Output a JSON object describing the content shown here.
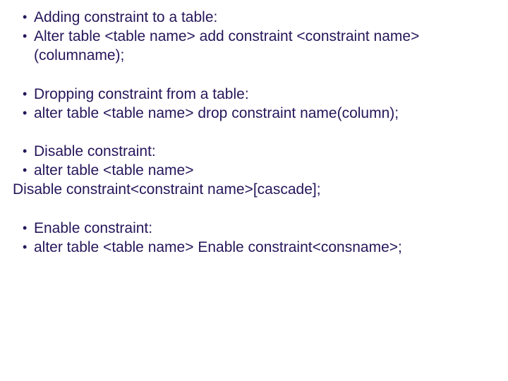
{
  "groups": [
    {
      "lines": [
        "Adding constraint to a table:",
        "Alter table <table name> add constraint <constraint name>(columname);"
      ]
    },
    {
      "lines": [
        "Dropping constraint from a table:",
        "alter table <table name> drop constraint name(column);"
      ]
    },
    {
      "lines": [
        "Disable constraint:",
        "alter table <table name>"
      ],
      "flush": "Disable constraint<constraint name>[cascade];"
    },
    {
      "lines": [
        "Enable constraint:",
        "alter table <table name> Enable constraint<consname>;"
      ]
    }
  ]
}
